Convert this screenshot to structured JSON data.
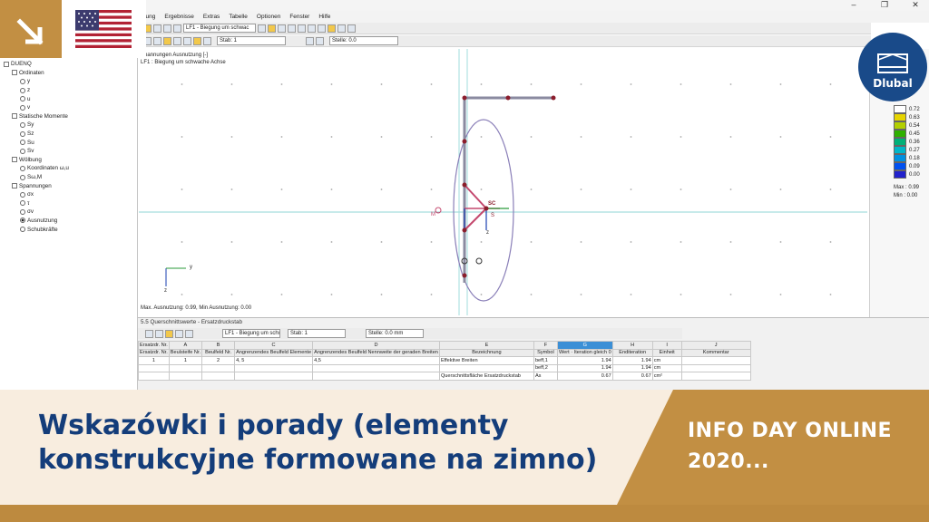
{
  "app": {
    "menu": [
      "…ung",
      "Ergebnisse",
      "Extras",
      "Tabelle",
      "Optionen",
      "Fenster",
      "Hilfe"
    ],
    "toolbar_top": {
      "load_case": "LF1 - Biegung um schwac",
      "member_label": "Stab: 1",
      "location_label": "Stelle: 0.0"
    }
  },
  "tree": {
    "items": [
      {
        "label": "DUENQ",
        "depth": 0,
        "kind": "box"
      },
      {
        "label": "Ordinaten",
        "depth": 1,
        "kind": "box"
      },
      {
        "label": "y",
        "depth": 2,
        "kind": "radio"
      },
      {
        "label": "z",
        "depth": 2,
        "kind": "radio"
      },
      {
        "label": "u",
        "depth": 2,
        "kind": "radio"
      },
      {
        "label": "v",
        "depth": 2,
        "kind": "radio"
      },
      {
        "label": "Statische Momente",
        "depth": 1,
        "kind": "box"
      },
      {
        "label": "Sy",
        "depth": 2,
        "kind": "radio"
      },
      {
        "label": "Sz",
        "depth": 2,
        "kind": "radio"
      },
      {
        "label": "Su",
        "depth": 2,
        "kind": "radio"
      },
      {
        "label": "Sv",
        "depth": 2,
        "kind": "radio"
      },
      {
        "label": "Wölbung",
        "depth": 1,
        "kind": "box"
      },
      {
        "label": "Koordinaten ω,u",
        "depth": 2,
        "kind": "radio"
      },
      {
        "label": "Sω,M",
        "depth": 2,
        "kind": "radio"
      },
      {
        "label": "Spannungen",
        "depth": 1,
        "kind": "box"
      },
      {
        "label": "σx",
        "depth": 2,
        "kind": "radio"
      },
      {
        "label": "τ",
        "depth": 2,
        "kind": "radio"
      },
      {
        "label": "σv",
        "depth": 2,
        "kind": "radio"
      },
      {
        "label": "Ausnutzung",
        "depth": 2,
        "kind": "radio",
        "selected": true
      },
      {
        "label": "Schubkräfte",
        "depth": 2,
        "kind": "radio"
      }
    ]
  },
  "canvas": {
    "title_line1": "Spannungen Ausnutzung [-]",
    "title_line2": "LF1 : Biegung um schwache Achse",
    "status": "Max. Ausnutzung: 0.99, Min Ausnutzung: 0.00",
    "labels": {
      "sc": "SC",
      "s": "S",
      "m": "M",
      "z": "z",
      "y": "y"
    }
  },
  "legend": {
    "values": [
      "0.72",
      "0.63",
      "0.54",
      "0.45",
      "0.36",
      "0.27",
      "0.18",
      "0.09",
      "0.00"
    ],
    "colors": [
      "#ffffff",
      "#e6d400",
      "#b3d000",
      "#2fb000",
      "#00b078",
      "#00b7c8",
      "#0090e0",
      "#0050f0",
      "#2222cc"
    ],
    "max_label": "Max : 0.99",
    "min_label": "Min : 0.00"
  },
  "lower_panel": {
    "title": "5.5 Querschnittswerte - Ersatzdruckstab",
    "load_case": "LF1 - Biegung um schw",
    "member": "Stab: 1",
    "location": "Stelle: 0.0 mm",
    "columns": [
      "Ersatzdr. Nr.",
      "A",
      "B",
      "C",
      "D",
      "E",
      "F",
      "G",
      "H",
      "I",
      "J"
    ],
    "subheaders": [
      "Ersatzdr. Nr.",
      "Beulsteife Nr.",
      "Beulfeld Nr.",
      "Angrenzendes Beulfeld Elemente",
      "Angrenzendes Beulfeld Nennweite der geraden Breiten",
      "Bezeichnung",
      "Symbol",
      "Iteration gleich 0",
      "Enditeration",
      "Einheit",
      "Kommentar"
    ],
    "wert_label": "Wert",
    "rows": [
      [
        "1",
        "1",
        "2",
        "4, 5",
        "4,5",
        "Effektive Breiten",
        "beff,1",
        "1.94",
        "1.94",
        "cm",
        ""
      ],
      [
        "",
        "",
        "",
        "",
        "",
        "",
        "beff,2",
        "1.94",
        "1.94",
        "cm",
        ""
      ],
      [
        "",
        "",
        "",
        "",
        "",
        "Querschnittsfläche Ersatzdruckstab",
        "As",
        "0.67",
        "0.67",
        "cm²",
        ""
      ]
    ]
  },
  "overlay": {
    "brand": "Dlubal",
    "title": "Wskazówki i porady (elementy konstrukcyjne formowane na zimno)",
    "badge": "INFO DAY ONLINE 2020...",
    "colors": {
      "gold": "#c28f43",
      "navy": "#143d7a",
      "cream": "#f8eddf",
      "blue_logo": "#194a89"
    }
  }
}
